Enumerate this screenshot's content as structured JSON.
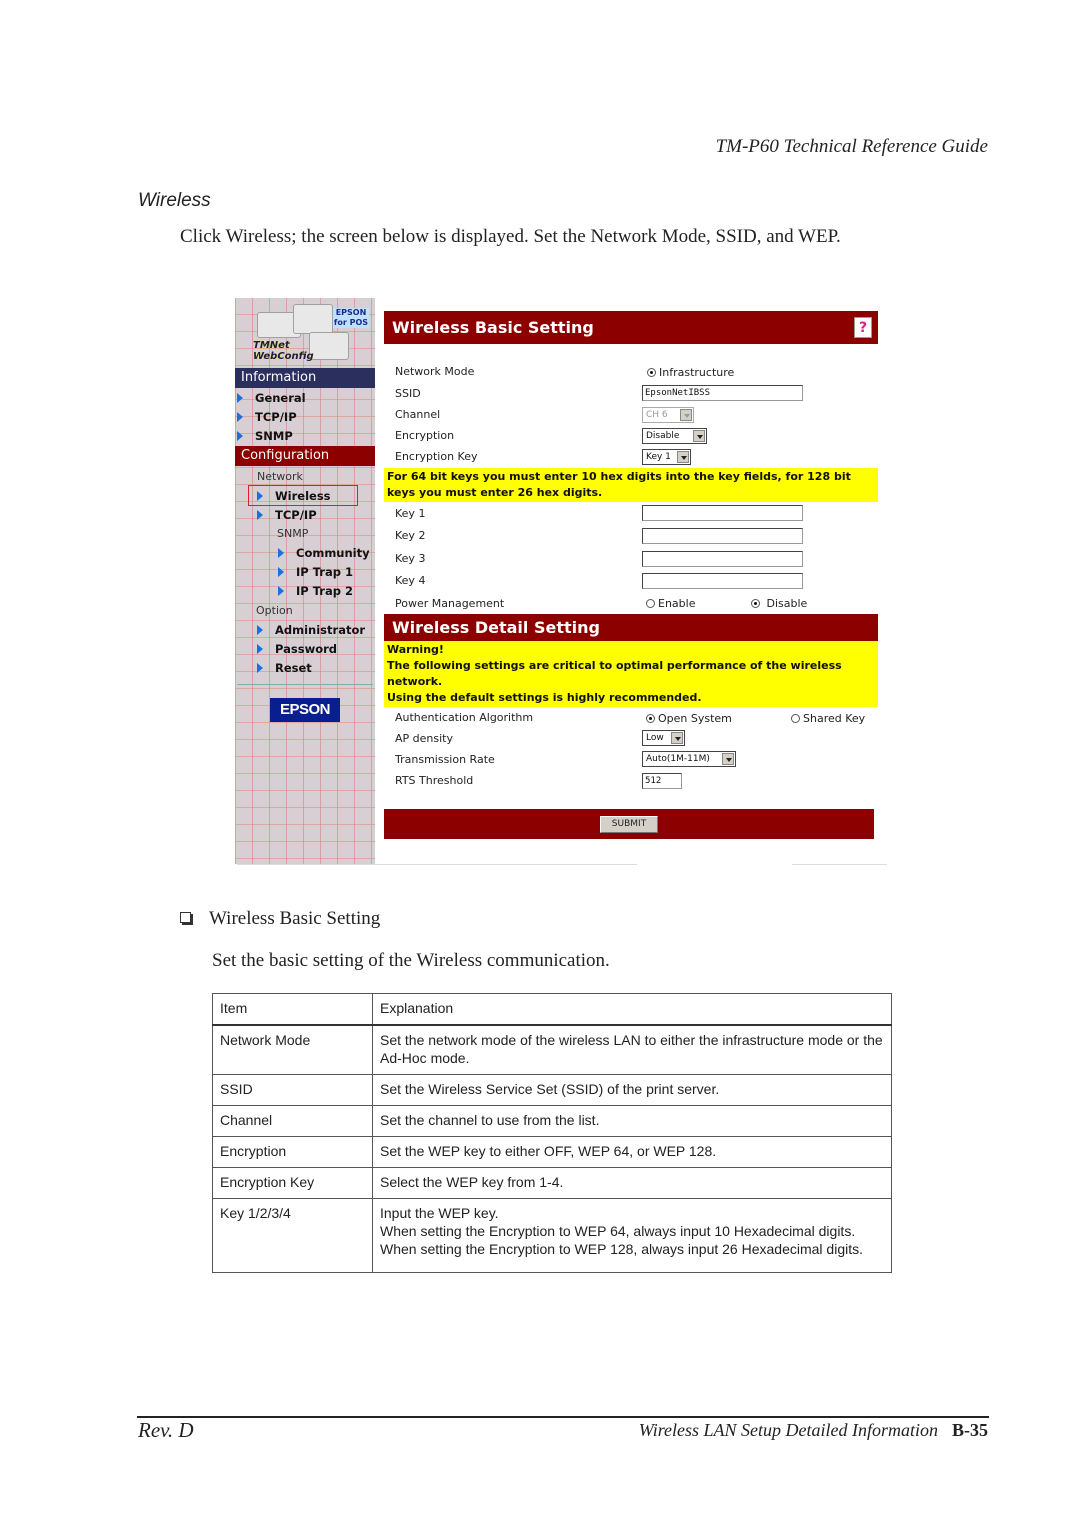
{
  "page": {
    "running_head": "TM-P60 Technical Reference Guide",
    "section_title": "Wireless",
    "intro": "Click Wireless; the screen below is displayed. Set the Network Mode, SSID, and WEP.",
    "footer_left": "Rev. D",
    "footer_right_text": "Wireless LAN Setup Detailed Information",
    "footer_page": "B-35"
  },
  "screenshot": {
    "logo": {
      "badge": "EPSON for POS",
      "title_line1": "TMNet",
      "title_line2": "WebConfig"
    },
    "sidebar": {
      "information_header": "Information",
      "information_items": [
        "General",
        "TCP/IP",
        "SNMP"
      ],
      "configuration_header": "Configuration",
      "network_label": "Network",
      "network_items": [
        "Wireless",
        "TCP/IP"
      ],
      "snmp_label": "SNMP",
      "snmp_items": [
        "Community",
        "IP Trap 1",
        "IP Trap 2"
      ],
      "option_label": "Option",
      "option_items": [
        "Administrator",
        "Password",
        "Reset"
      ],
      "selected_item": "Wireless",
      "epson_logo": "EPSON"
    },
    "basic": {
      "title": "Wireless Basic Setting",
      "labels": {
        "network_mode": "Network Mode",
        "ssid": "SSID",
        "channel": "Channel",
        "encryption": "Encryption",
        "encryption_key": "Encryption Key",
        "key1": "Key 1",
        "key2": "Key 2",
        "key3": "Key 3",
        "key4": "Key 4",
        "power_management": "Power Management"
      },
      "network_mode_option": "Infrastructure",
      "network_mode_selected": true,
      "ssid_value": "EpsonNetIBSS",
      "channel_value": "CH 6",
      "encryption_value": "Disable",
      "encryption_key_value": "Key 1",
      "key_values": [
        "",
        "",
        "",
        ""
      ],
      "hex_note": "For 64 bit keys you must enter 10 hex digits into the key fields, for 128 bit keys you must enter 26 hex digits.",
      "power_options": [
        "Enable",
        "Disable"
      ],
      "power_selected": "Disable"
    },
    "detail": {
      "title": "Wireless Detail Setting",
      "warning_title": "Warning!",
      "warning_line1": "The following settings are critical to optimal performance of the wireless network.",
      "warning_line2": "Using the default settings is highly recommended.",
      "labels": {
        "auth": "Authentication Algorithm",
        "ap_density": "AP density",
        "tx_rate": "Transmission Rate",
        "rts": "RTS Threshold"
      },
      "auth_options": [
        "Open System",
        "Shared Key"
      ],
      "auth_selected": "Open System",
      "ap_density_value": "Low",
      "tx_rate_value": "Auto(1M-11M)",
      "rts_value": "512",
      "submit_label": "SUBMIT"
    }
  },
  "bullet_heading": "Wireless Basic Setting",
  "bullet_para": "Set the basic setting of the Wireless communication.",
  "table": {
    "headers": [
      "Item",
      "Explanation"
    ],
    "rows": [
      {
        "item": "Network Mode",
        "explanation": "Set the network mode of the wireless LAN to either  the infrastructure mode or the Ad-Hoc mode."
      },
      {
        "item": "SSID",
        "explanation": "Set the Wireless Service Set (SSID) of the print server."
      },
      {
        "item": "Channel",
        "explanation": "Set the channel to use from the list."
      },
      {
        "item": "Encryption",
        "explanation": "Set the WEP key to either OFF, WEP 64, or WEP 128."
      },
      {
        "item": "Encryption Key",
        "explanation": "Select the WEP key from 1-4."
      },
      {
        "item": "Key 1/2/3/4",
        "explanation_lines": [
          "Input the WEP key.",
          "When setting the Encryption to WEP 64, always input 10 Hexadecimal digits. When setting the Encryption to WEP 128, always input 26 Hexadecimal digits."
        ]
      }
    ]
  },
  "colors": {
    "banner_red": "#8c0000",
    "info_header": "#2b2f5e",
    "note_yellow": "#ffff00",
    "arrow_blue": "#1d6fe0",
    "selection_red": "#e02020",
    "epson_blue": "#0a1f8f"
  }
}
